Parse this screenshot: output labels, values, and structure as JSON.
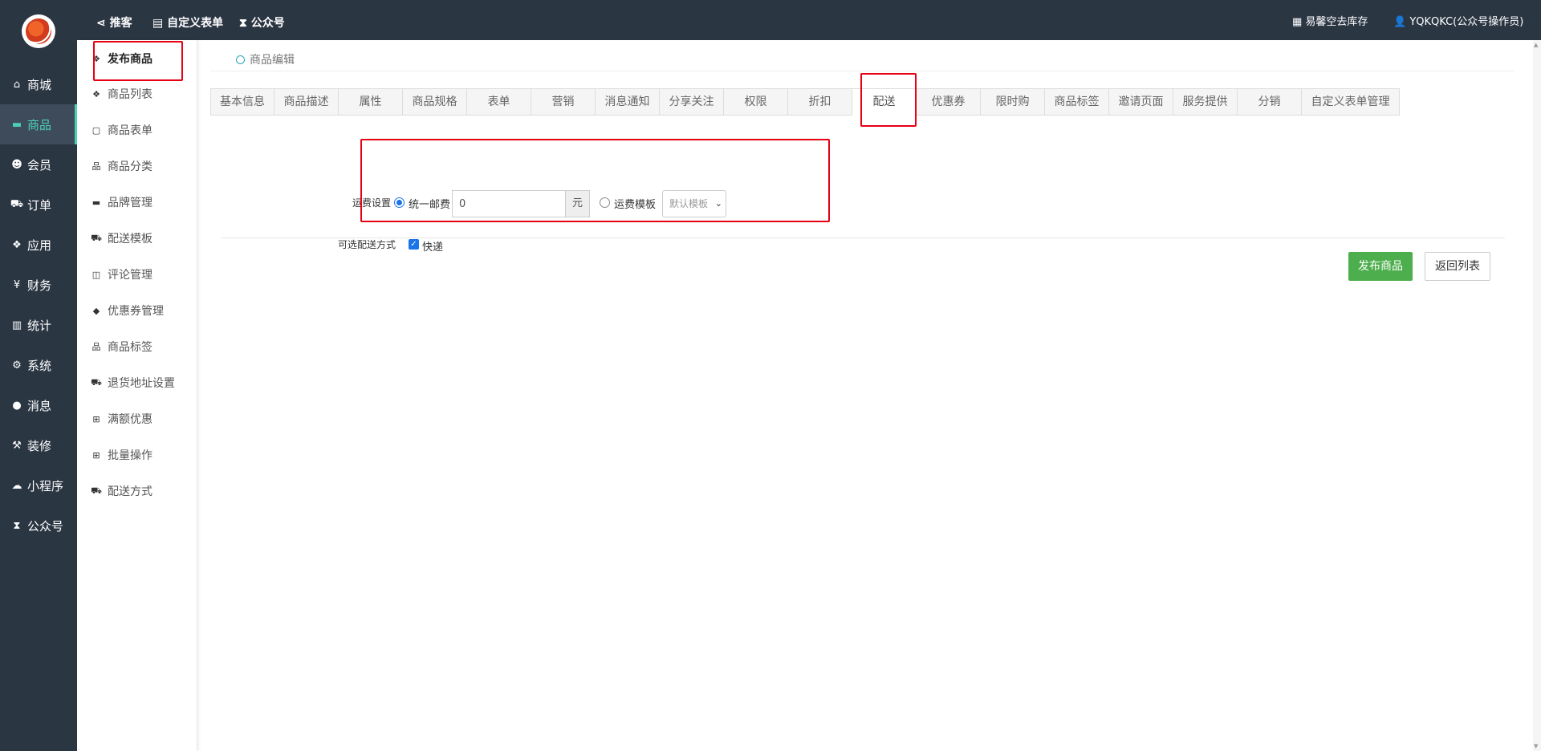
{
  "colors": {
    "sidebar_bg": "#2b3643",
    "accent": "#4cd1b4",
    "publish_button": "#4cae4c",
    "highlight_box": "#e60012"
  },
  "header": {
    "links": [
      {
        "icon": "share-icon",
        "label": "推客"
      },
      {
        "icon": "form-icon",
        "label": "自定义表单"
      },
      {
        "icon": "hourglass-icon",
        "label": "公众号"
      }
    ],
    "store": {
      "icon": "grid-icon",
      "label": "易馨空去库存"
    },
    "user": {
      "icon": "user-icon",
      "label": "YQKQKC(公众号操作员)"
    }
  },
  "sidebar": {
    "items": [
      {
        "icon": "home-icon",
        "label": "商城"
      },
      {
        "icon": "goods-icon",
        "label": "商品"
      },
      {
        "icon": "users-icon",
        "label": "会员"
      },
      {
        "icon": "cart-icon",
        "label": "订单"
      },
      {
        "icon": "apps-icon",
        "label": "应用"
      },
      {
        "icon": "yen-icon",
        "label": "财务"
      },
      {
        "icon": "chart-icon",
        "label": "统计"
      },
      {
        "icon": "gears-icon",
        "label": "系统"
      },
      {
        "icon": "comment-icon",
        "label": "消息"
      },
      {
        "icon": "gavel-icon",
        "label": "装修"
      },
      {
        "icon": "wechat-icon",
        "label": "小程序"
      },
      {
        "icon": "hourglass-icon",
        "label": "公众号"
      }
    ],
    "active": "商品"
  },
  "subnav": {
    "items": [
      {
        "icon": "cubes-icon",
        "label": "发布商品"
      },
      {
        "icon": "cubes-icon",
        "label": "商品列表"
      },
      {
        "icon": "file-icon",
        "label": "商品表单"
      },
      {
        "icon": "sitemap-icon",
        "label": "商品分类"
      },
      {
        "icon": "briefcase-icon",
        "label": "品牌管理"
      },
      {
        "icon": "truck-icon",
        "label": "配送模板"
      },
      {
        "icon": "columns-icon",
        "label": "评论管理"
      },
      {
        "icon": "tags-icon",
        "label": "优惠券管理"
      },
      {
        "icon": "sitemap-icon",
        "label": "商品标签"
      },
      {
        "icon": "truck-icon",
        "label": "退货地址设置"
      },
      {
        "icon": "gift-icon",
        "label": "满额优惠"
      },
      {
        "icon": "gift-icon",
        "label": "批量操作"
      },
      {
        "icon": "truck-icon",
        "label": "配送方式"
      }
    ],
    "active": "发布商品"
  },
  "breadcrumb": "商品编辑",
  "tabs": [
    "基本信息",
    "商品描述",
    "属性",
    "商品规格",
    "表单",
    "营销",
    "消息通知",
    "分享关注",
    "权限",
    "折扣",
    "配送",
    "优惠券",
    "限时购",
    "商品标签",
    "邀请页面",
    "服务提供",
    "分销",
    "自定义表单管理"
  ],
  "active_tab": "配送",
  "shipping": {
    "label": "运费设置",
    "unified_label": "统一邮费",
    "unified_checked": true,
    "fee_value": "0",
    "fee_unit": "元",
    "template_label": "运费模板",
    "template_checked": false,
    "template_select": "默认模板",
    "delivery_label": "可选配送方式",
    "express_label": "快递",
    "express_checked": true
  },
  "actions": {
    "publish": "发布商品",
    "back": "返回列表"
  }
}
